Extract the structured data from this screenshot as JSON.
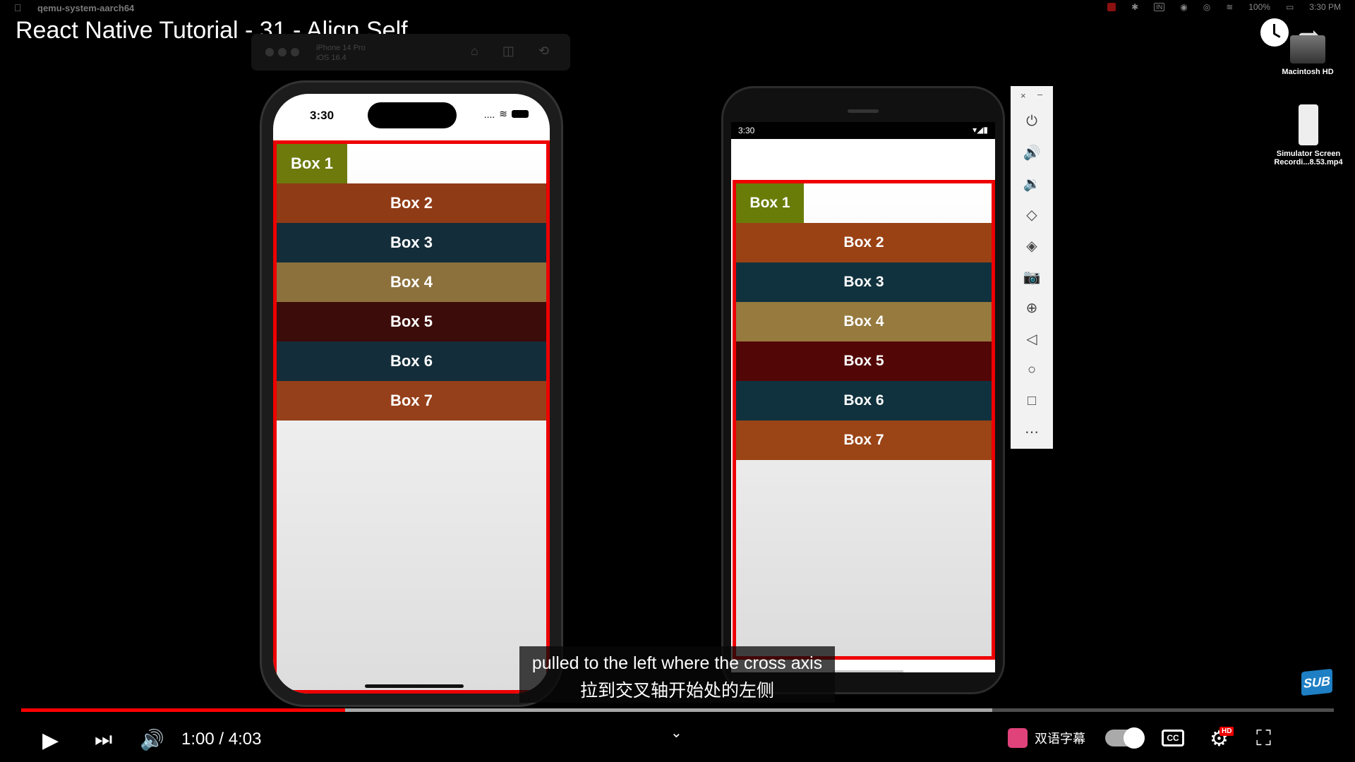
{
  "menubar": {
    "app_name": "qemu-system-aarch64",
    "battery": "100%",
    "time": "3:30 PM",
    "in_badge": "IN"
  },
  "video": {
    "title": "React Native Tutorial - 31 - Align Self",
    "current_time": "1:00",
    "duration": "4:03",
    "time_display": "1:00 / 4:03",
    "progress_fraction": 0.247,
    "buffer_fraction": 0.74
  },
  "desktop": {
    "drive_label": "Macintosh HD",
    "file_label_line1": "Simulator Screen",
    "file_label_line2": "Recordi...8.53.mp4"
  },
  "ios_sim": {
    "device_name": "iPhone 14 Pro",
    "os_version": "iOS 16.4",
    "status_time": "3:30",
    "signal": "....",
    "boxes": [
      {
        "label": "Box 1",
        "color": "#6e7a0c"
      },
      {
        "label": "Box 2",
        "color": "#8f3b16"
      },
      {
        "label": "Box 3",
        "color": "#142d3a"
      },
      {
        "label": "Box 4",
        "color": "#8c713d"
      },
      {
        "label": "Box 5",
        "color": "#3c0c0a"
      },
      {
        "label": "Box 6",
        "color": "#142d3a"
      },
      {
        "label": "Box 7",
        "color": "#95401a"
      }
    ]
  },
  "android_emu": {
    "status_time": "3:30",
    "boxes": [
      {
        "label": "Box 1",
        "color": "#6a7c08"
      },
      {
        "label": "Box 2",
        "color": "#9a4214"
      },
      {
        "label": "Box 3",
        "color": "#10323e"
      },
      {
        "label": "Box 4",
        "color": "#967a3e"
      },
      {
        "label": "Box 5",
        "color": "#530606"
      },
      {
        "label": "Box 6",
        "color": "#10323e"
      },
      {
        "label": "Box 7",
        "color": "#9b4416"
      }
    ]
  },
  "emulator_panel": {
    "close": "×",
    "minimize": "–"
  },
  "subtitles": {
    "en": "pulled to the left where the cross axis",
    "zh": "拉到交叉轴开始处的左侧"
  },
  "controls": {
    "bilingual_label": "双语字幕",
    "cc_label": "CC",
    "hd_badge": "HD",
    "sub_logo": "SUB"
  },
  "colors": {
    "border_red": "#e00",
    "progress_red": "#f00"
  }
}
